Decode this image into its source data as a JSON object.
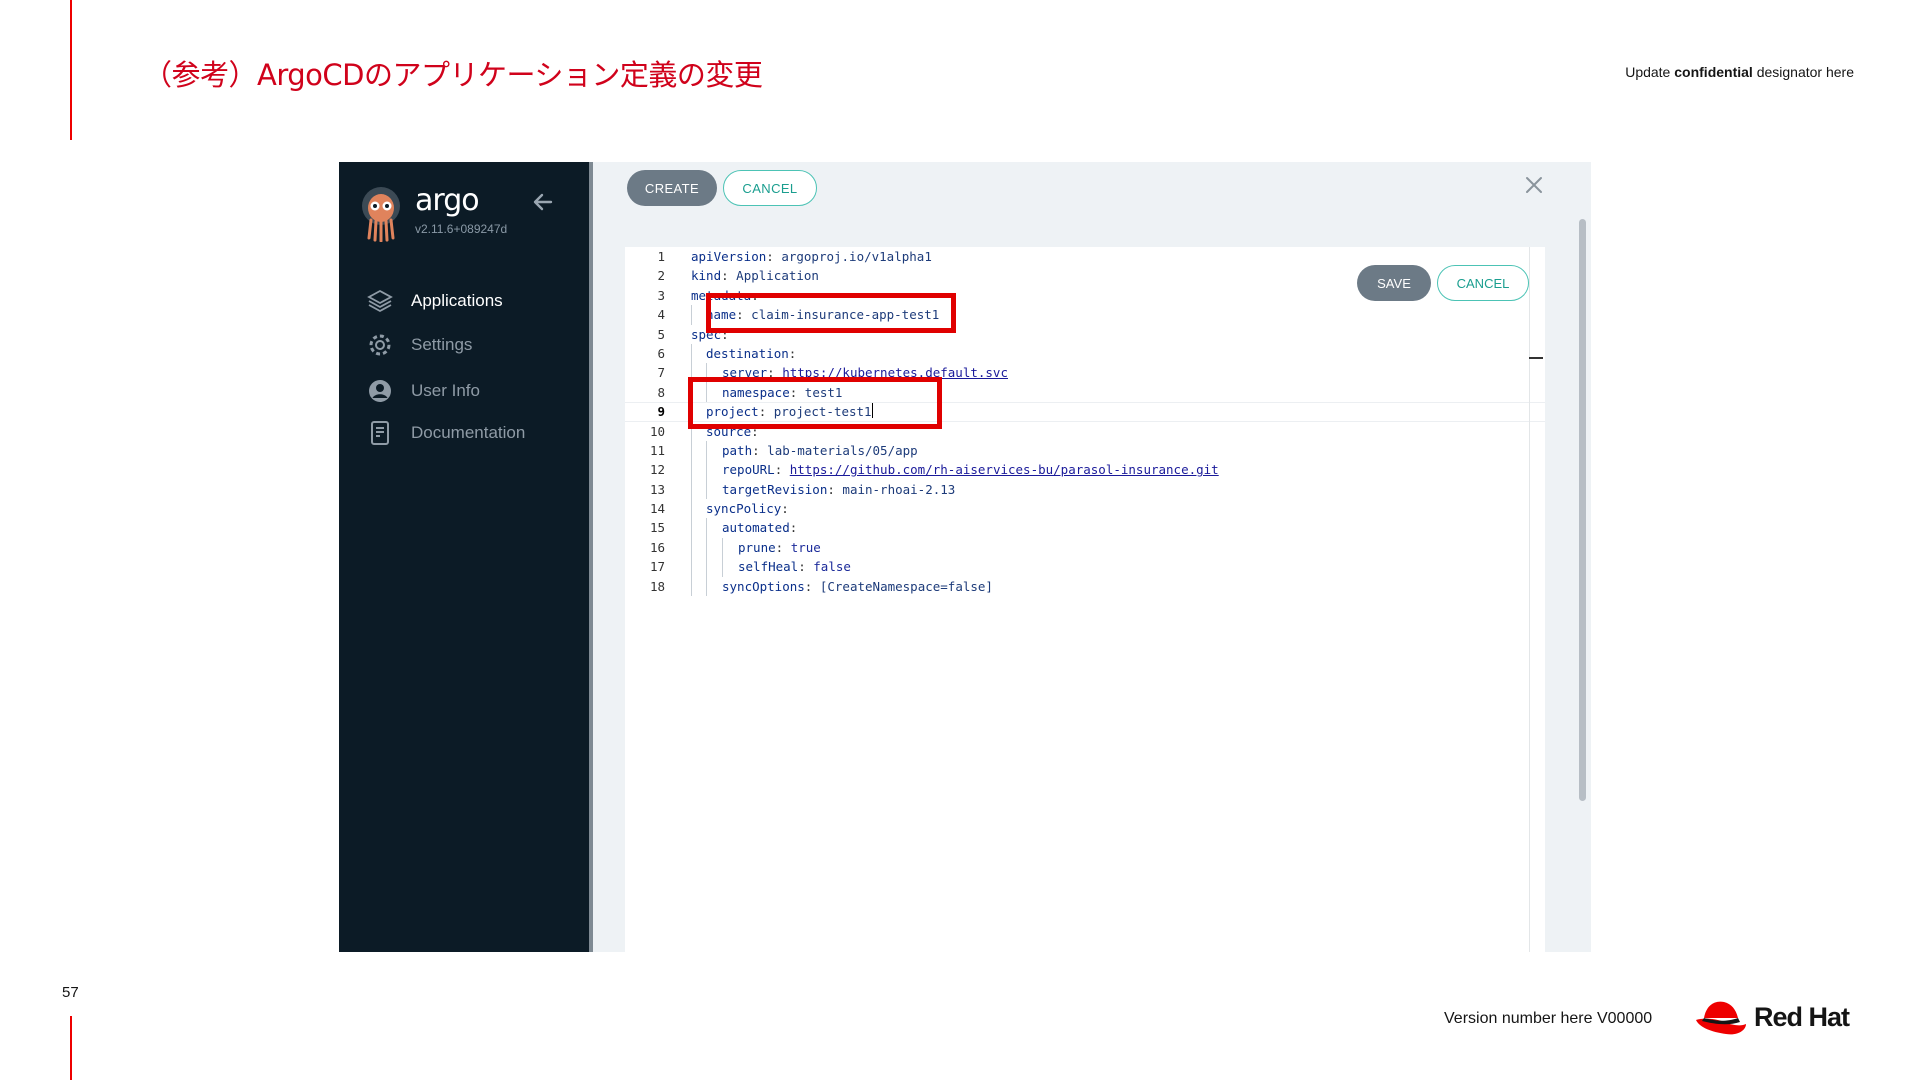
{
  "slide": {
    "title": "（参考）ArgoCDのアプリケーション定義の変更",
    "confidential_pre": "Update ",
    "confidential_bold": "confidential",
    "confidential_post": " designator here",
    "page_number": "57",
    "version": "Version number here V00000",
    "logo_text": "Red Hat"
  },
  "colors": {
    "accent_red": "#ee0000",
    "sidebar_bg": "#0c1b26",
    "teal": "#1a9e8f"
  },
  "sidebar": {
    "brand": "argo",
    "version": "v2.11.6+089247d",
    "items": [
      {
        "label": "Applications",
        "icon": "layers-icon",
        "active": true
      },
      {
        "label": "Settings",
        "icon": "gear-icon",
        "active": false
      },
      {
        "label": "User Info",
        "icon": "user-icon",
        "active": false
      },
      {
        "label": "Documentation",
        "icon": "document-icon",
        "active": false
      }
    ]
  },
  "toolbar": {
    "create_label": "CREATE",
    "cancel_label": "CANCEL"
  },
  "editor": {
    "save_label": "SAVE",
    "cancel_label": "CANCEL",
    "line_numbers": [
      "1",
      "2",
      "3",
      "4",
      "5",
      "6",
      "7",
      "8",
      "9",
      "10",
      "11",
      "12",
      "13",
      "14",
      "15",
      "16",
      "17",
      "18"
    ],
    "current_line": "9",
    "lines": [
      {
        "key": "apiVersion",
        "value": "argoproj.io/v1alpha1"
      },
      {
        "key": "kind",
        "value": "Application"
      },
      {
        "key": "metadata",
        "value": ""
      },
      {
        "key": "name",
        "value": "claim-insurance-app-test1"
      },
      {
        "key": "spec",
        "value": ""
      },
      {
        "key": "destination",
        "value": ""
      },
      {
        "key": "server",
        "value": "https://kubernetes.default.svc"
      },
      {
        "key": "namespace",
        "value": "test1"
      },
      {
        "key": "project",
        "value": "project-test1"
      },
      {
        "key": "source",
        "value": ""
      },
      {
        "key": "path",
        "value": "lab-materials/05/app"
      },
      {
        "key": "repoURL",
        "value": "https://github.com/rh-aiservices-bu/parasol-insurance.git"
      },
      {
        "key": "targetRevision",
        "value": "main-rhoai-2.13"
      },
      {
        "key": "syncPolicy",
        "value": ""
      },
      {
        "key": "automated",
        "value": ""
      },
      {
        "key": "prune",
        "value": "true"
      },
      {
        "key": "selfHeal",
        "value": "false"
      },
      {
        "key": "syncOptions",
        "value": "[CreateNamespace=false]"
      }
    ]
  }
}
